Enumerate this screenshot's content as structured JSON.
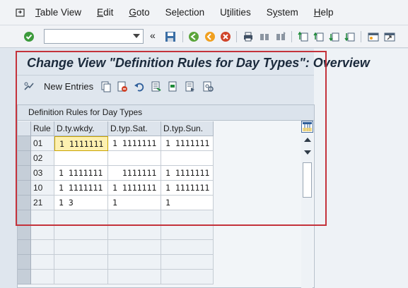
{
  "menu": {
    "items": [
      {
        "label": "Table View",
        "underline": "T"
      },
      {
        "label": "Edit",
        "underline": "E"
      },
      {
        "label": "Goto",
        "underline": "G"
      },
      {
        "label": "Selection",
        "underline": "l"
      },
      {
        "label": "Utilities",
        "underline": "t"
      },
      {
        "label": "System",
        "underline": "y"
      },
      {
        "label": "Help",
        "underline": "H"
      }
    ]
  },
  "toolbar": {
    "command_field_value": "",
    "icons": [
      "enter-icon",
      "command-dropdown-icon",
      "back-collapse-icon",
      "save-icon",
      "back-icon",
      "exit-icon",
      "cancel-icon",
      "print-icon",
      "find-icon",
      "find-next-icon",
      "first-page-icon",
      "previous-page-icon",
      "next-page-icon",
      "last-page-icon",
      "new-session-icon",
      "shortcut-icon"
    ]
  },
  "page": {
    "title": "Change View \"Definition Rules for Day Types\": Overview"
  },
  "app_toolbar": {
    "new_entries_label": "New Entries",
    "icons": [
      "display-change-icon",
      "new-entries-icon",
      "copy-icon",
      "delete-icon",
      "undo-icon",
      "select-all-icon",
      "select-block-icon",
      "deselect-all-icon",
      "configure-icon"
    ]
  },
  "table": {
    "caption": "Definition Rules for Day Types",
    "columns": [
      "Rule",
      "D.ty.wkdy.",
      "D.typ.Sat.",
      "D.typ.Sun."
    ],
    "rows": [
      {
        "rule": "01",
        "wkdy": "1 1111111",
        "sat": "1 1111111",
        "sun": "1 1111111",
        "active": true
      },
      {
        "rule": "02",
        "wkdy": "",
        "sat": "",
        "sun": ""
      },
      {
        "rule": "03",
        "wkdy": "1 1111111",
        "sat": "  1111111",
        "sun": "1 1111111"
      },
      {
        "rule": "10",
        "wkdy": "1 1111111",
        "sat": "1 1111111",
        "sun": "1 1111111"
      },
      {
        "rule": "21",
        "wkdy": "1 3",
        "sat": "1",
        "sun": "1"
      }
    ],
    "empty_rows": 5
  },
  "colors": {
    "highlight_border": "#c4323b",
    "active_cell": "#fdf0b0",
    "title_text": "#1b2a3c"
  }
}
